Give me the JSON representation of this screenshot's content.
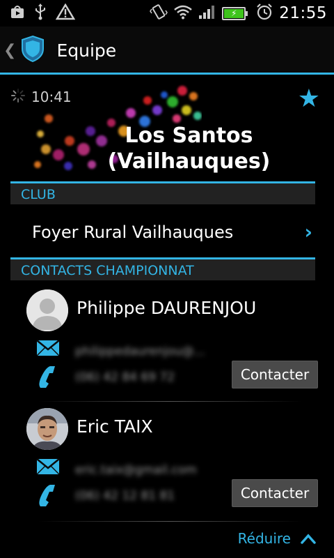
{
  "status_bar": {
    "time": "21:55",
    "left_icons": [
      "play-store-icon",
      "usb-icon",
      "warning-icon"
    ],
    "right_icons": [
      "vibrate-icon",
      "wifi-icon",
      "signal-icon",
      "battery-icon",
      "alarm-icon"
    ],
    "battery_color": "#3ec41c"
  },
  "action_bar": {
    "title": "Equipe",
    "accent": "#33b5e5"
  },
  "team": {
    "match_time": "10:41",
    "name_line1": "Los Santos",
    "name_line2": "(Vailhauques)",
    "favorite": true
  },
  "club_section": {
    "header": "CLUB",
    "club_name": "Foyer Rural Vailhauques"
  },
  "contacts_section": {
    "header": "CONTACTS  CHAMPIONNAT",
    "contacts": [
      {
        "name": "Philippe DAURENJOU",
        "email": "philippedaurenjou@...",
        "phone": "(06) 42 84 69 72",
        "button": "Contacter",
        "avatar": "default-avatar"
      },
      {
        "name": "Eric TAIX",
        "email": "eric.taix@gmail.com",
        "phone": "(06) 42 12 81 81",
        "button": "Contacter",
        "avatar": "photo-avatar"
      }
    ],
    "reduce_label": "Réduire"
  }
}
